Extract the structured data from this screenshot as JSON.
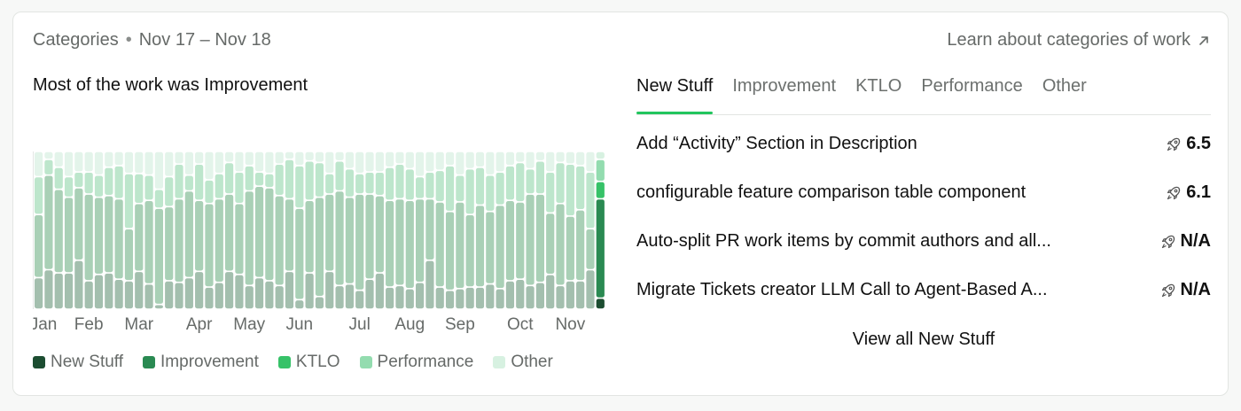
{
  "header": {
    "section": "Categories",
    "date_range": "Nov 17 – Nov 18",
    "learn_link": "Learn about categories of work"
  },
  "headline": "Most of the work was Improvement",
  "colors": {
    "new_stuff": "#1c4d31",
    "improvement": "#2a8a52",
    "ktlo": "#36c268",
    "performance": "#93dcaf",
    "other": "#d7f1e1",
    "accent": "#22c55e"
  },
  "legend": [
    {
      "label": "New Stuff",
      "color": "#1c4d31"
    },
    {
      "label": "Improvement",
      "color": "#2a8a52"
    },
    {
      "label": "KTLO",
      "color": "#36c268"
    },
    {
      "label": "Performance",
      "color": "#93dcaf"
    },
    {
      "label": "Other",
      "color": "#d7f1e1"
    }
  ],
  "tabs": [
    {
      "label": "New Stuff",
      "active": true
    },
    {
      "label": "Improvement",
      "active": false
    },
    {
      "label": "KTLO",
      "active": false
    },
    {
      "label": "Performance",
      "active": false
    },
    {
      "label": "Other",
      "active": false
    }
  ],
  "items": [
    {
      "title": "Add “Activity” Section in Description",
      "score": "6.5",
      "icon": "rocket-icon"
    },
    {
      "title": "configurable feature comparison table component",
      "score": "6.1",
      "icon": "rocket-icon"
    },
    {
      "title": "Auto-split PR work items by commit authors and all...",
      "score": "N/A",
      "icon": "rocket-icon"
    },
    {
      "title": "Migrate Tickets creator LLM Call to Agent-Based A...",
      "score": "N/A",
      "icon": "rocket-icon"
    }
  ],
  "view_all": "View all New Stuff",
  "chart_data": {
    "type": "bar",
    "stacked": true,
    "normalized": true,
    "series_order": [
      "New Stuff",
      "Improvement",
      "KTLO",
      "Performance",
      "Other"
    ],
    "x_tick_labels": [
      {
        "label": "Jan",
        "index": 0
      },
      {
        "label": "Feb",
        "index": 5
      },
      {
        "label": "Mar",
        "index": 10
      },
      {
        "label": "Apr",
        "index": 16
      },
      {
        "label": "May",
        "index": 21
      },
      {
        "label": "Jun",
        "index": 26
      },
      {
        "label": "Jul",
        "index": 32
      },
      {
        "label": "Aug",
        "index": 37
      },
      {
        "label": "Sep",
        "index": 42
      },
      {
        "label": "Oct",
        "index": 48
      },
      {
        "label": "Nov",
        "index": 53
      }
    ],
    "highlight_index": 56,
    "bars": [
      [
        0.2,
        0.4,
        0.0,
        0.24,
        0.16
      ],
      [
        0.25,
        0.6,
        0.0,
        0.1,
        0.05
      ],
      [
        0.23,
        0.53,
        0.0,
        0.14,
        0.1
      ],
      [
        0.23,
        0.48,
        0.0,
        0.13,
        0.16
      ],
      [
        0.31,
        0.46,
        0.0,
        0.1,
        0.13
      ],
      [
        0.18,
        0.55,
        0.0,
        0.14,
        0.13
      ],
      [
        0.22,
        0.49,
        0.0,
        0.14,
        0.15
      ],
      [
        0.23,
        0.49,
        0.0,
        0.18,
        0.1
      ],
      [
        0.19,
        0.51,
        0.0,
        0.21,
        0.09
      ],
      [
        0.18,
        0.33,
        0.0,
        0.35,
        0.14
      ],
      [
        0.24,
        0.43,
        0.0,
        0.19,
        0.14
      ],
      [
        0.16,
        0.53,
        0.0,
        0.16,
        0.15
      ],
      [
        0.03,
        0.61,
        0.0,
        0.12,
        0.24
      ],
      [
        0.18,
        0.47,
        0.0,
        0.19,
        0.16
      ],
      [
        0.17,
        0.53,
        0.0,
        0.22,
        0.08
      ],
      [
        0.2,
        0.55,
        0.0,
        0.1,
        0.15
      ],
      [
        0.24,
        0.45,
        0.0,
        0.23,
        0.08
      ],
      [
        0.14,
        0.53,
        0.0,
        0.15,
        0.18
      ],
      [
        0.17,
        0.53,
        0.0,
        0.16,
        0.14
      ],
      [
        0.24,
        0.49,
        0.0,
        0.2,
        0.07
      ],
      [
        0.22,
        0.45,
        0.0,
        0.2,
        0.13
      ],
      [
        0.15,
        0.6,
        0.0,
        0.16,
        0.09
      ],
      [
        0.2,
        0.58,
        0.0,
        0.09,
        0.13
      ],
      [
        0.18,
        0.59,
        0.0,
        0.09,
        0.14
      ],
      [
        0.15,
        0.57,
        0.0,
        0.2,
        0.08
      ],
      [
        0.24,
        0.46,
        0.0,
        0.25,
        0.05
      ],
      [
        0.06,
        0.58,
        0.0,
        0.27,
        0.09
      ],
      [
        0.23,
        0.46,
        0.0,
        0.25,
        0.06
      ],
      [
        0.08,
        0.63,
        0.0,
        0.22,
        0.07
      ],
      [
        0.24,
        0.49,
        0.0,
        0.13,
        0.14
      ],
      [
        0.15,
        0.6,
        0.0,
        0.19,
        0.06
      ],
      [
        0.16,
        0.55,
        0.0,
        0.18,
        0.11
      ],
      [
        0.12,
        0.61,
        0.0,
        0.13,
        0.14
      ],
      [
        0.19,
        0.54,
        0.0,
        0.14,
        0.13
      ],
      [
        0.23,
        0.49,
        0.0,
        0.15,
        0.13
      ],
      [
        0.14,
        0.55,
        0.0,
        0.21,
        0.1
      ],
      [
        0.15,
        0.55,
        0.0,
        0.22,
        0.08
      ],
      [
        0.13,
        0.56,
        0.0,
        0.2,
        0.11
      ],
      [
        0.17,
        0.53,
        0.0,
        0.14,
        0.16
      ],
      [
        0.31,
        0.39,
        0.0,
        0.17,
        0.13
      ],
      [
        0.14,
        0.54,
        0.0,
        0.2,
        0.12
      ],
      [
        0.12,
        0.5,
        0.0,
        0.29,
        0.09
      ],
      [
        0.13,
        0.55,
        0.0,
        0.17,
        0.15
      ],
      [
        0.14,
        0.46,
        0.0,
        0.29,
        0.11
      ],
      [
        0.14,
        0.52,
        0.0,
        0.24,
        0.1
      ],
      [
        0.16,
        0.46,
        0.0,
        0.23,
        0.15
      ],
      [
        0.13,
        0.53,
        0.0,
        0.21,
        0.13
      ],
      [
        0.18,
        0.51,
        0.0,
        0.22,
        0.09
      ],
      [
        0.19,
        0.49,
        0.0,
        0.25,
        0.07
      ],
      [
        0.15,
        0.58,
        0.0,
        0.16,
        0.11
      ],
      [
        0.17,
        0.56,
        0.0,
        0.21,
        0.06
      ],
      [
        0.22,
        0.39,
        0.0,
        0.26,
        0.13
      ],
      [
        0.15,
        0.52,
        0.0,
        0.26,
        0.07
      ],
      [
        0.18,
        0.41,
        0.0,
        0.33,
        0.08
      ],
      [
        0.18,
        0.45,
        0.0,
        0.28,
        0.09
      ],
      [
        0.25,
        0.26,
        0.0,
        0.36,
        0.13
      ],
      [
        0.07,
        0.63,
        0.11,
        0.14,
        0.05
      ]
    ]
  }
}
